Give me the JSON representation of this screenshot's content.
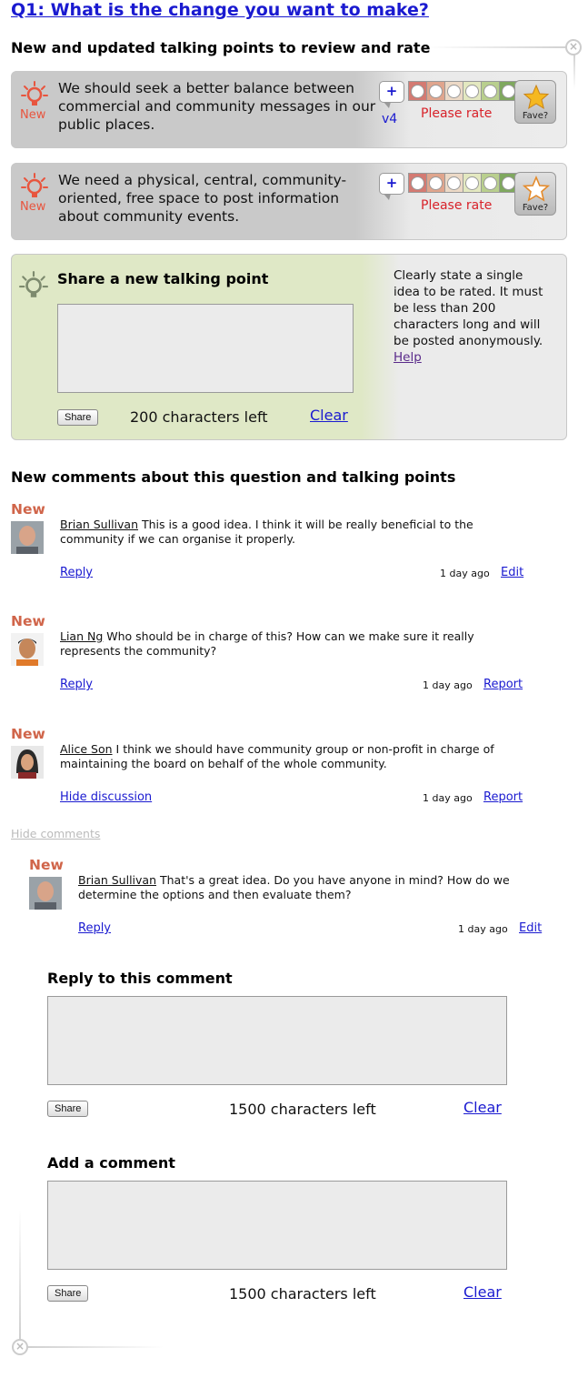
{
  "question": {
    "title": "Q1: What is the change you want to make?"
  },
  "talking_points_section": {
    "heading": "New and updated talking points to review and rate",
    "items": [
      {
        "new_label": "New",
        "text": "We should seek a better balance between commercial and community messages in our public places.",
        "plus": "+",
        "version": "v4",
        "rate_prompt": "Please rate",
        "fave_label": "Fave?"
      },
      {
        "new_label": "New",
        "text": "We need a physical, central, community-oriented, free space to post information about community events.",
        "plus": "+",
        "version": "",
        "rate_prompt": "Please rate",
        "fave_label": "Fave?"
      }
    ],
    "rating_colors": [
      "#d47a72",
      "#e0a58d",
      "#ecd9c6",
      "#e3e8c0",
      "#b9cf8e",
      "#7fa85e"
    ]
  },
  "share_box": {
    "heading": "Share a new talking point",
    "textarea_value": "",
    "share_button": "Share",
    "chars_left": "200 characters left",
    "clear": "Clear",
    "help_text": "Clearly state a single idea to be rated. It must be less than 200 characters long and will be posted anonymously.",
    "help_link": "Help"
  },
  "comments_section": {
    "heading": "New comments about this question and talking points",
    "comments": [
      {
        "new_label": "New",
        "author": "Brian Sullivan",
        "text": "This is a good idea. I think it will be really beneficial to the community if we can organise it properly.",
        "reply": "Reply",
        "time": "1 day ago",
        "action": "Edit"
      },
      {
        "new_label": "New",
        "author": "Lian Ng",
        "text": "Who should be in charge of this? How can we make sure it really represents the community?",
        "reply": "Reply",
        "time": "1 day ago",
        "action": "Report"
      },
      {
        "new_label": "New",
        "author": "Alice Son",
        "text": "I think we should have community group or non-profit in charge of maintaining the board on behalf of the whole community.",
        "reply": "Hide discussion",
        "time": "1 day ago",
        "action": "Report"
      }
    ],
    "hide_comments": "Hide comments",
    "nested_reply": {
      "new_label": "New",
      "author": "Brian Sullivan",
      "text": "That's a great idea. Do you have anyone in mind? How do we determine the options and then evaluate them?",
      "reply": "Reply",
      "time": "1 day ago",
      "action": "Edit"
    }
  },
  "reply_form": {
    "heading": "Reply to this comment",
    "textarea_value": "",
    "share_button": "Share",
    "chars_left": "1500 characters left",
    "clear": "Clear"
  },
  "add_comment_form": {
    "heading": "Add a comment",
    "textarea_value": "",
    "share_button": "Share",
    "chars_left": "1500 characters left",
    "clear": "Clear"
  }
}
